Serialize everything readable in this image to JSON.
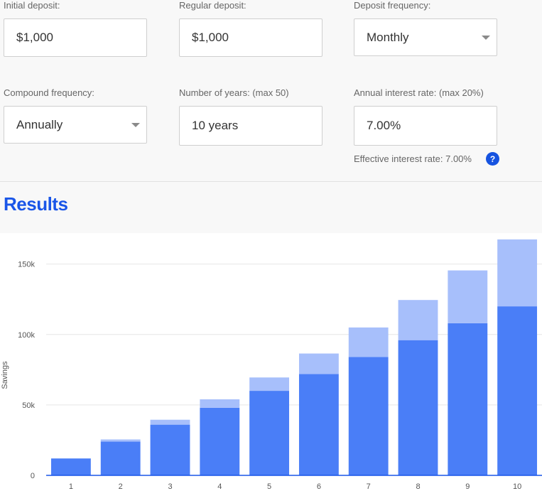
{
  "form": {
    "initial_deposit": {
      "label": "Initial deposit:",
      "value": "$1,000"
    },
    "regular_deposit": {
      "label": "Regular deposit:",
      "value": "$1,000"
    },
    "deposit_frequency": {
      "label": "Deposit frequency:",
      "value": "Monthly"
    },
    "compound_frequency": {
      "label": "Compound frequency:",
      "value": "Annually"
    },
    "years": {
      "label": "Number of years: (max 50)",
      "value": "10 years"
    },
    "interest_rate": {
      "label": "Annual interest rate: (max 20%)",
      "value": "7.00%"
    },
    "effective_rate": "Effective interest rate: 7.00%",
    "help_icon": "?"
  },
  "results": {
    "title": "Results"
  },
  "colors": {
    "accent": "#1a56e8",
    "deposits": "#4a7ef7",
    "interest": "#a7bffb"
  },
  "chart_data": {
    "type": "bar",
    "stacked": true,
    "ylabel": "Savings",
    "xlabel": "",
    "categories": [
      "1",
      "2",
      "3",
      "4",
      "5",
      "6",
      "7",
      "8",
      "9",
      "10"
    ],
    "series": [
      {
        "values": [
          12000,
          24000,
          36000,
          48000,
          60000,
          72000,
          84000,
          96000,
          108000,
          120000
        ]
      },
      {
        "values": [
          0,
          1500,
          3500,
          6000,
          9500,
          14500,
          21000,
          28500,
          37500,
          47500
        ]
      }
    ],
    "yticks": [
      0,
      50000,
      100000,
      150000
    ],
    "ytick_labels": [
      "0",
      "50k",
      "100k",
      "150k"
    ],
    "ylim": [
      0,
      170000
    ],
    "grid": true
  }
}
